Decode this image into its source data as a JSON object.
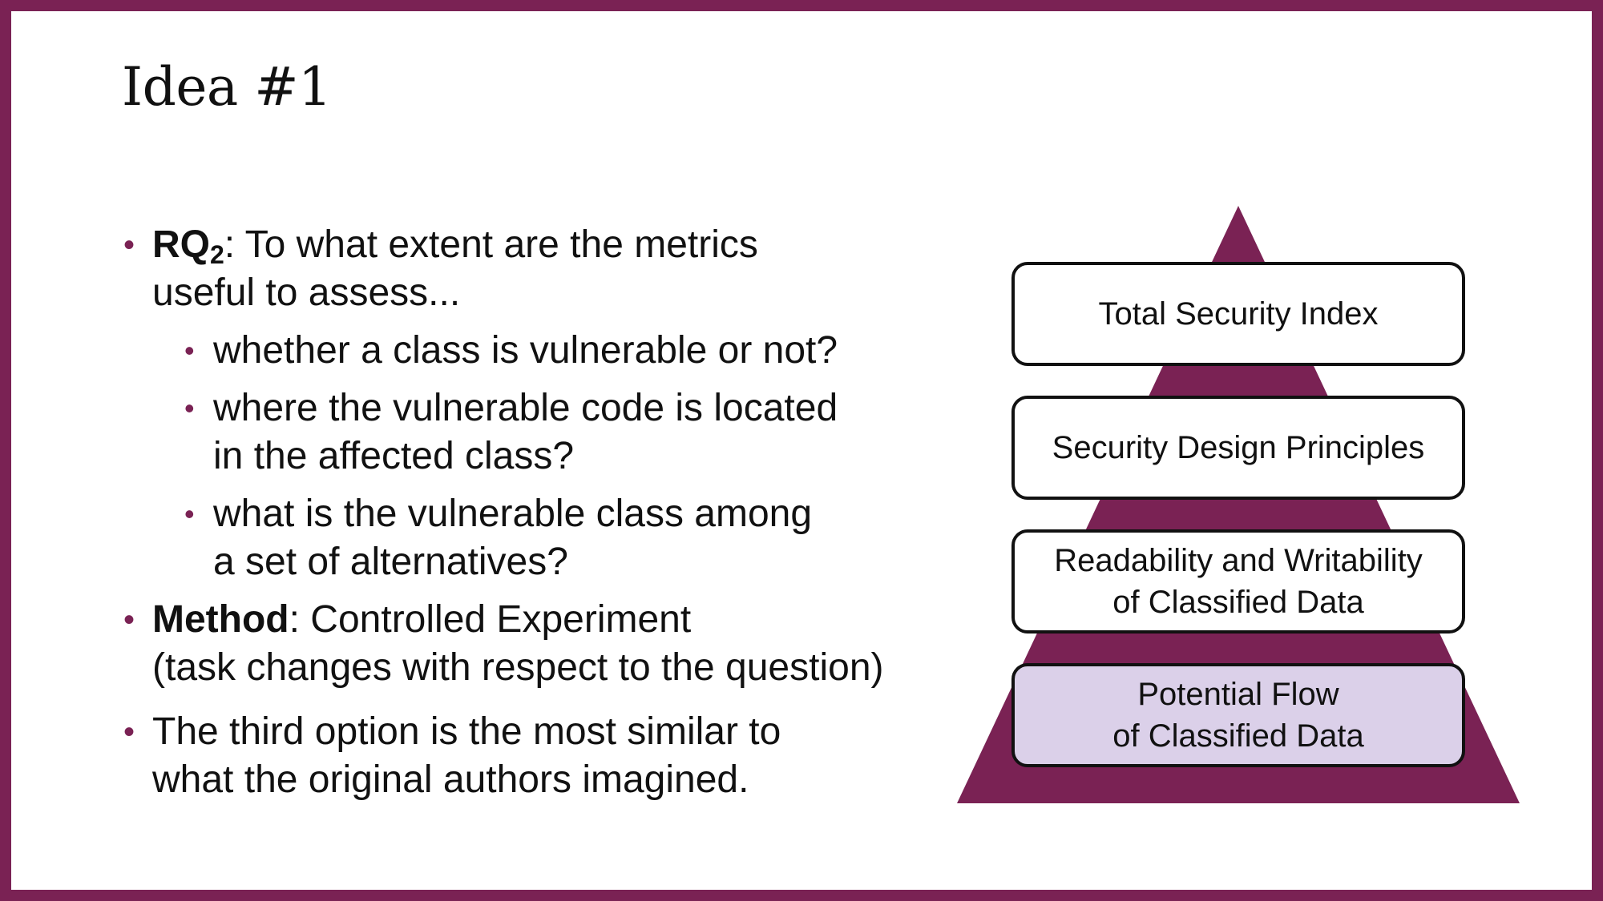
{
  "title": "Idea #1",
  "bullets": {
    "rq_label": "RQ",
    "rq_sub": "2",
    "rq_text_line1": ": To what extent are the metrics",
    "rq_text_line2": "useful to assess...",
    "sub1": "whether a class is vulnerable or not?",
    "sub2_line1": "where the vulnerable code is located",
    "sub2_line2": "in the affected class?",
    "sub3_line1": "what is the vulnerable class among",
    "sub3_line2": "a set of alternatives?",
    "method_label": "Method",
    "method_line1": ": Controlled Experiment",
    "method_line2": "(task changes with respect to the question)",
    "third_line1": "The third option is the most similar to",
    "third_line2": "what the original authors imagined."
  },
  "pyramid": {
    "fill_color": "#7a2254",
    "highlight_color": "#dbd0e9",
    "levels": [
      {
        "line1": "Total Security Index",
        "line2": ""
      },
      {
        "line1": "Security Design Principles",
        "line2": ""
      },
      {
        "line1": "Readability and Writability",
        "line2": "of Classified Data"
      },
      {
        "line1": "Potential Flow",
        "line2": "of Classified Data"
      }
    ]
  }
}
